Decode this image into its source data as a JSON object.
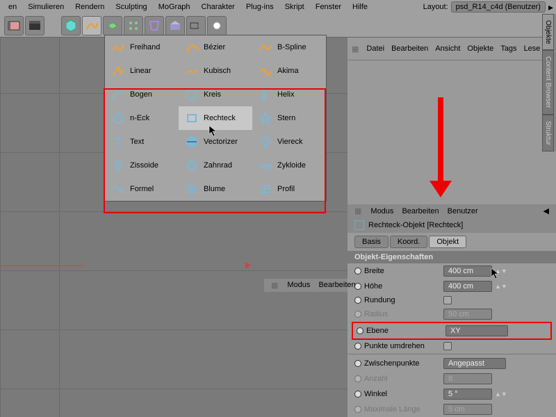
{
  "menubar": {
    "items": [
      "en",
      "Simulieren",
      "Rendern",
      "Sculpting",
      "MoGraph",
      "Charakter",
      "Plug-ins",
      "Skript",
      "Fenster",
      "Hilfe"
    ],
    "layout_label": "Layout:",
    "layout_value": "psd_R14_c4d (Benutzer)"
  },
  "objects_menu": [
    "Datei",
    "Bearbeiten",
    "Ansicht",
    "Objekte",
    "Tags",
    "Lese"
  ],
  "spline_menu": {
    "rows": [
      [
        {
          "label": "Freihand",
          "icon": "freehand",
          "color": "#e8a040"
        },
        {
          "label": "Bézier",
          "icon": "bezier",
          "color": "#e8a040"
        },
        {
          "label": "B-Spline",
          "icon": "bspline",
          "color": "#e8a040"
        }
      ],
      [
        {
          "label": "Linear",
          "icon": "linear",
          "color": "#e8a040"
        },
        {
          "label": "Kubisch",
          "icon": "kubisch",
          "color": "#e8a040"
        },
        {
          "label": "Akima",
          "icon": "akima",
          "color": "#e8a040"
        }
      ],
      [
        {
          "label": "Bogen",
          "icon": "arc",
          "color": "#7ab8d8"
        },
        {
          "label": "Kreis",
          "icon": "circle",
          "color": "#7ab8d8"
        },
        {
          "label": "Helix",
          "icon": "helix",
          "color": "#7ab8d8"
        }
      ],
      [
        {
          "label": "n-Eck",
          "icon": "hexagon",
          "color": "#7ab8d8"
        },
        {
          "label": "Rechteck",
          "icon": "rect",
          "color": "#7ab8d8",
          "hover": true
        },
        {
          "label": "Stern",
          "icon": "star",
          "color": "#7ab8d8"
        }
      ],
      [
        {
          "label": "Text",
          "icon": "text",
          "color": "#7ab8d8"
        },
        {
          "label": "Vectorizer",
          "icon": "vectorizer",
          "color": "#7ab8d8"
        },
        {
          "label": "Viereck",
          "icon": "diamond",
          "color": "#7ab8d8"
        }
      ],
      [
        {
          "label": "Zissoide",
          "icon": "zissoid",
          "color": "#7ab8d8"
        },
        {
          "label": "Zahnrad",
          "icon": "gear",
          "color": "#7ab8d8"
        },
        {
          "label": "Zykloide",
          "icon": "cycloid",
          "color": "#7ab8d8"
        }
      ],
      [
        {
          "label": "Formel",
          "icon": "formula",
          "color": "#7ab8d8"
        },
        {
          "label": "Blume",
          "icon": "flower",
          "color": "#7ab8d8"
        },
        {
          "label": "Profil",
          "icon": "profile",
          "color": "#7ab8d8"
        }
      ]
    ]
  },
  "mid_panel": {
    "items": [
      "Modus",
      "Bearbeiten"
    ]
  },
  "attr": {
    "header": [
      "Modus",
      "Bearbeiten",
      "Benutzer"
    ],
    "object_title": "Rechteck-Objekt [Rechteck]",
    "tabs": [
      {
        "label": "Basis"
      },
      {
        "label": "Koord."
      },
      {
        "label": "Objekt",
        "active": true
      }
    ],
    "section": "Objekt-Eigenschaften",
    "props": [
      {
        "label": "Breite",
        "value": "400 cm",
        "type": "num"
      },
      {
        "label": "Höhe",
        "value": "400 cm",
        "type": "num"
      },
      {
        "label": "Rundung",
        "type": "check"
      },
      {
        "label": "Radius",
        "value": "50 cm",
        "type": "num",
        "disabled": true
      },
      {
        "label": "Ebene",
        "value": "XY",
        "type": "select",
        "highlight": true
      },
      {
        "label": "Punkte umdrehen",
        "type": "check"
      }
    ],
    "props2": [
      {
        "label": "Zwischenpunkte",
        "value": "Angepasst",
        "type": "select"
      },
      {
        "label": "Anzahl",
        "value": "8",
        "type": "num",
        "disabled": true
      },
      {
        "label": "Winkel",
        "value": "5 °",
        "type": "num"
      },
      {
        "label": "Maximale Länge",
        "value": "5 cm",
        "type": "num",
        "disabled": true
      }
    ]
  },
  "side_tabs": [
    "Objekte",
    "Content Browser",
    "Struktur"
  ]
}
